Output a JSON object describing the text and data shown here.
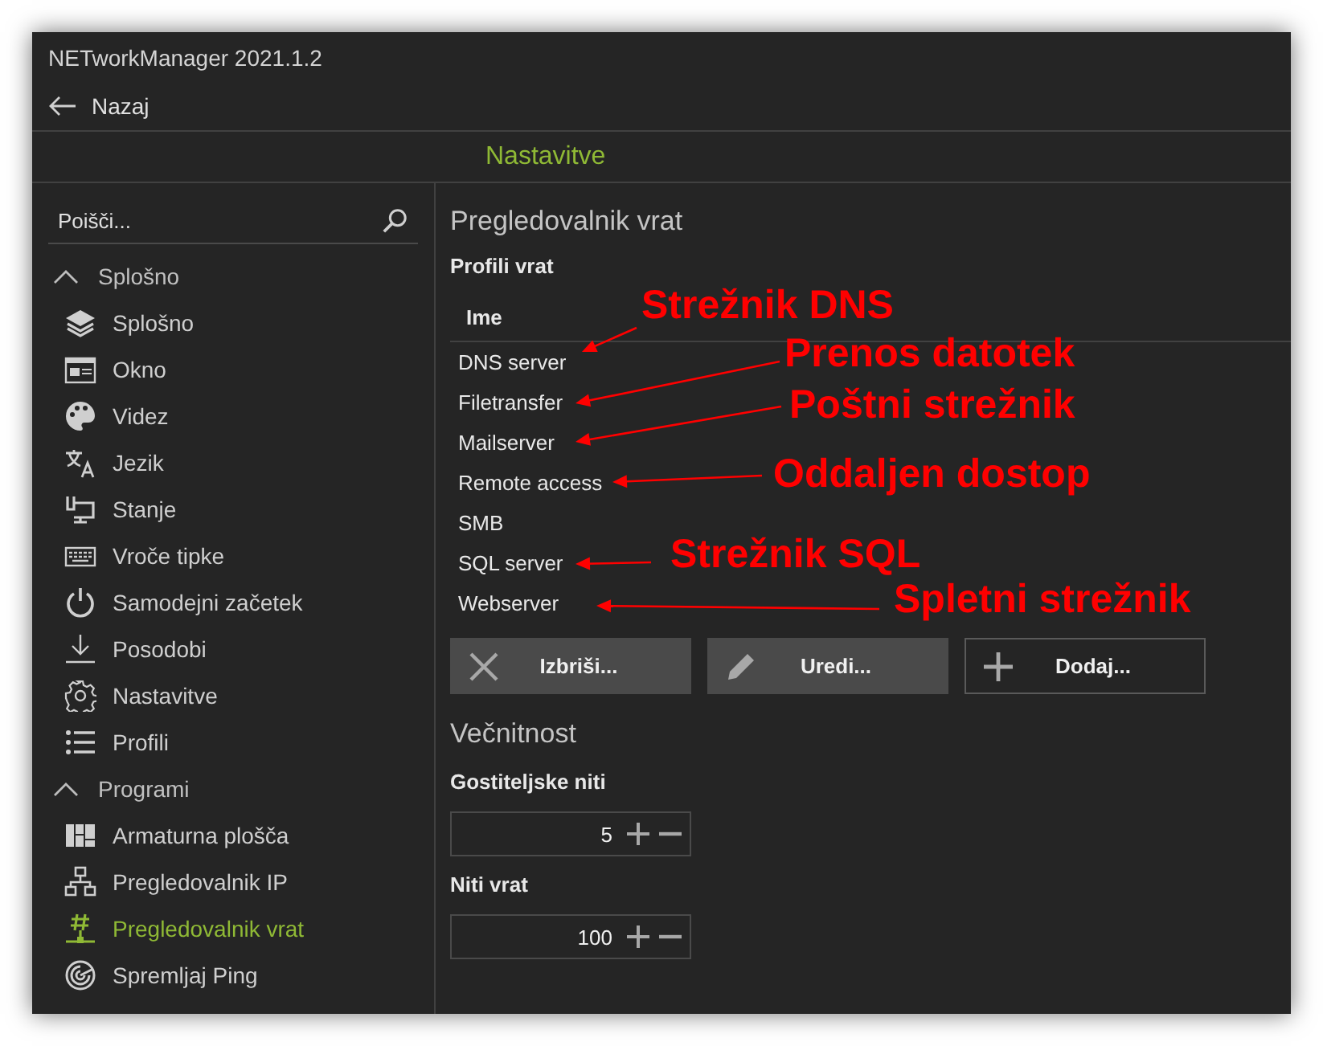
{
  "window": {
    "title": "NETworkManager 2021.1.2"
  },
  "back_button": {
    "label": "Nazaj"
  },
  "header": {
    "title": "Nastavitve"
  },
  "sidebar": {
    "search": {
      "placeholder": "Poišči..."
    },
    "groups": [
      {
        "label": "Splošno",
        "expanded": true,
        "items": [
          {
            "label": "Splošno",
            "selected": false
          },
          {
            "label": "Okno",
            "selected": false
          },
          {
            "label": "Videz",
            "selected": false
          },
          {
            "label": "Jezik",
            "selected": false
          },
          {
            "label": "Stanje",
            "selected": false
          },
          {
            "label": "Vroče tipke",
            "selected": false
          },
          {
            "label": "Samodejni začetek",
            "selected": false
          },
          {
            "label": "Posodobi",
            "selected": false
          },
          {
            "label": "Nastavitve",
            "selected": false
          },
          {
            "label": "Profili",
            "selected": false
          }
        ]
      },
      {
        "label": "Programi",
        "expanded": true,
        "items": [
          {
            "label": "Armaturna plošča",
            "selected": false
          },
          {
            "label": "Pregledovalnik IP",
            "selected": false
          },
          {
            "label": "Pregledovalnik vrat",
            "selected": true
          },
          {
            "label": "Spremljaj Ping",
            "selected": false
          }
        ]
      }
    ]
  },
  "content": {
    "title": "Pregledovalnik vrat",
    "profiles": {
      "label": "Profili vrat",
      "columns": [
        "Ime"
      ],
      "rows": [
        {
          "name": "DNS server",
          "annotation": "Strežnik DNS"
        },
        {
          "name": "Filetransfer",
          "annotation": "Prenos datotek"
        },
        {
          "name": "Mailserver",
          "annotation": "Poštni strežnik"
        },
        {
          "name": "Remote access",
          "annotation": "Oddaljen dostop"
        },
        {
          "name": "SMB"
        },
        {
          "name": "SQL server",
          "annotation": "Strežnik SQL"
        },
        {
          "name": "Webserver",
          "annotation": "Spletni strežnik"
        }
      ]
    },
    "buttons": [
      {
        "kind": "delete",
        "label": "Izbriši..."
      },
      {
        "kind": "edit",
        "label": "Uredi..."
      },
      {
        "kind": "add",
        "label": "Dodaj..."
      }
    ],
    "section": "Večnitnost",
    "fields": [
      {
        "label": "Gostiteljske niti",
        "value": "5"
      },
      {
        "label": "Niti vrat",
        "value": "100"
      }
    ]
  }
}
